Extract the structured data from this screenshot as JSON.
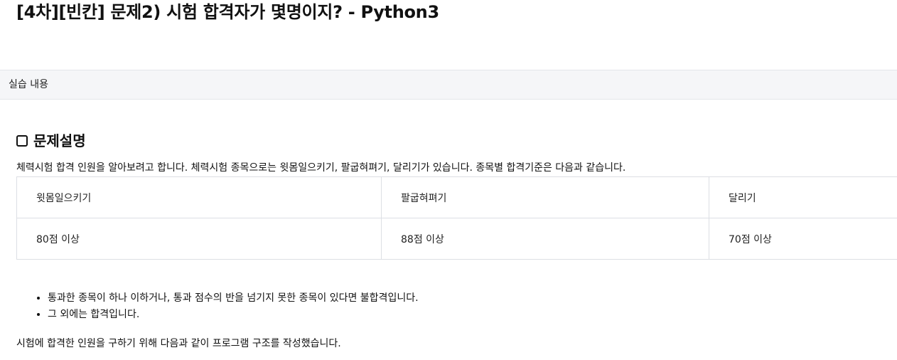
{
  "page": {
    "title": "[4차][빈칸] 문제2) 시험 합격자가 몇명이지? - Python3"
  },
  "tabs": {
    "active_label": "실습 내용"
  },
  "problem": {
    "section_title": "문제설명",
    "section_icon": "square-outline-icon",
    "intro": "체력시험 합격 인원을 알아보려고 합니다. 체력시험 종목으로는 윗몸일으키기, 팔굽혀펴기, 달리기가 있습니다. 종목별 합격기준은 다음과 같습니다.",
    "table": {
      "headers": [
        "윗몸일으키기",
        "팔굽혀펴기",
        "달리기"
      ],
      "row": [
        "80점 이상",
        "88점 이상",
        "70점 이상"
      ]
    },
    "bullets": [
      "통과한 종목이 하나 이하거나, 통과 점수의 반을 넘기지 못한 종목이 있다면 불합격입니다.",
      "그 외에는 합격입니다."
    ],
    "closing": "시험에 합격한 인원을 구하기 위해 다음과 같이 프로그램 구조를 작성했습니다."
  }
}
